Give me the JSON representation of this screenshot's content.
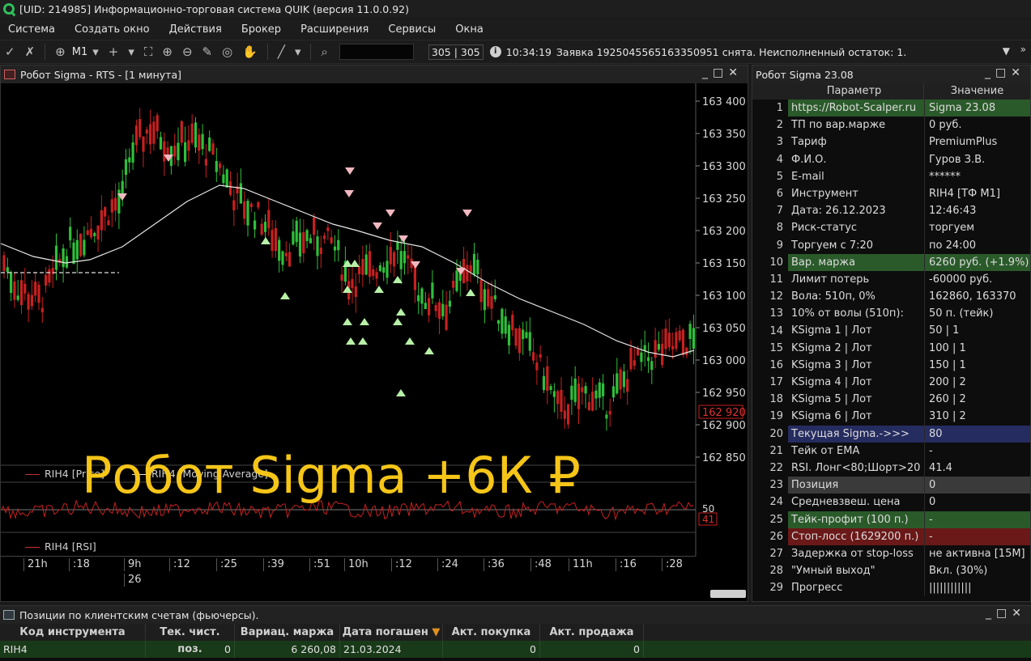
{
  "titlebar": {
    "title": "[UID: 214985] Информационно-торговая система QUIK (версия 11.0.0.92)"
  },
  "menu": [
    "Система",
    "Создать окно",
    "Действия",
    "Брокер",
    "Расширения",
    "Сервисы",
    "Окна"
  ],
  "toolbar": {
    "timeframe": "M1",
    "counter": "305 | 305",
    "time": "10:34:19",
    "message": "Заявка 1925045565163350951 снята. Неисполненный остаток: 1."
  },
  "chart_window": {
    "title": "Робот Sigma - RTS   - [1 минута]",
    "price_ticks": [
      "163 400",
      "163 350",
      "163 300",
      "163 250",
      "163 200",
      "163 150",
      "163 100",
      "163 050",
      "163 000",
      "162 950",
      "162 900",
      "162 850"
    ],
    "current_price": "162 920",
    "legend_price": "RIH4 [Price]",
    "legend_ma": "RIH4 [Moving Average]",
    "rsi_legend": "RIH4 [RSI]",
    "rsi_level": "50",
    "rsi_value": "41",
    "time_labels": [
      "21h",
      ":18",
      "9h",
      ":12",
      ":25",
      ":39",
      ":51",
      "10h",
      ":12",
      ":24",
      ":36",
      ":48",
      "11h",
      ":16",
      ":28"
    ],
    "date_label": "26",
    "overlay_text": "Робот Sigma +6К ₽"
  },
  "param_window": {
    "title": "Робот Sigma 23.08",
    "col_param": "Параметр",
    "col_value": "Значение",
    "rows": [
      {
        "n": "1",
        "p": "https://Robot-Scalper.ru",
        "v": "Sigma 23.08"
      },
      {
        "n": "2",
        "p": "ТП по вар.марже",
        "v": "0 руб."
      },
      {
        "n": "3",
        "p": "Тариф",
        "v": "PremiumPlus"
      },
      {
        "n": "4",
        "p": "Ф.И.О.",
        "v": "Гуров З.В."
      },
      {
        "n": "5",
        "p": "E-mail",
        "v": "******"
      },
      {
        "n": "6",
        "p": "Инструмент",
        "v": "RIH4 [ТФ M1]"
      },
      {
        "n": "7",
        "p": "Дата: 26.12.2023",
        "v": "12:46:43"
      },
      {
        "n": "8",
        "p": "Риск-статус",
        "v": "торгуем"
      },
      {
        "n": "9",
        "p": "Торгуем с 7:20",
        "v": "по 24:00"
      },
      {
        "n": "10",
        "p": "Вар. маржа",
        "v": "6260 руб. (+1.9%)"
      },
      {
        "n": "11",
        "p": "Лимит потерь",
        "v": "-60000 руб."
      },
      {
        "n": "12",
        "p": "Вола: 510п, 0%",
        "v": "162860, 163370"
      },
      {
        "n": "13",
        "p": "10% от волы (510п):",
        "v": "50 п. (тейк)"
      },
      {
        "n": "14",
        "p": "KSigma 1 | Лот",
        "v": "50 | 1"
      },
      {
        "n": "15",
        "p": "KSigma 2 | Лот",
        "v": "100 | 1"
      },
      {
        "n": "16",
        "p": "KSigma 3 | Лот",
        "v": "150 | 1"
      },
      {
        "n": "17",
        "p": "KSigma 4 | Лот",
        "v": "200 | 2"
      },
      {
        "n": "18",
        "p": "KSigma 5 | Лот",
        "v": "260 | 2"
      },
      {
        "n": "19",
        "p": "KSigma 6 | Лот",
        "v": "310 | 2"
      },
      {
        "n": "20",
        "p": "Текущая Sigma.->>>",
        "v": "80"
      },
      {
        "n": "21",
        "p": "Тейк от EMA",
        "v": " -"
      },
      {
        "n": "22",
        "p": "RSI. Лонг<80;Шорт>20",
        "v": "41.4"
      },
      {
        "n": "23",
        "p": "Позиция",
        "v": "0"
      },
      {
        "n": "24",
        "p": "Средневзвеш. цена",
        "v": "0"
      },
      {
        "n": "25",
        "p": "Тейк-профит (100 п.)",
        "v": "-"
      },
      {
        "n": "26",
        "p": "Стоп-лосс (1629200 п.)",
        "v": "-"
      },
      {
        "n": "27",
        "p": "Задержка от stop-loss",
        "v": "не активна [15M]"
      },
      {
        "n": "28",
        "p": "\"Умный выход\"",
        "v": "Вкл. (30%)"
      },
      {
        "n": "29",
        "p": "Прогресс",
        "v": "||||||||||||"
      }
    ],
    "highlights": {
      "1": "hl-green",
      "10": "hl-green",
      "20": "hl-blue",
      "23": "hl-gray",
      "25": "hl-green",
      "26": "hl-red"
    }
  },
  "positions_window": {
    "title": "Позиции по клиентским счетам (фьючерсы).",
    "columns": [
      "Код инструмента",
      "Тек. чист. поз.",
      "Вариац. маржа",
      "Дата погашен",
      "Акт. покупка",
      "Акт. продажа"
    ],
    "row": [
      "RIH4",
      "0",
      "6 260,08",
      "21.03.2024",
      "0",
      "0"
    ]
  },
  "colors": {
    "bull": "#2fbf3a",
    "bear": "#c82020",
    "ma_line": "#e8e8e8",
    "overlay": "#f5c518",
    "sell_marker": "#f2b8c0",
    "buy_marker": "#b8f0a8"
  }
}
